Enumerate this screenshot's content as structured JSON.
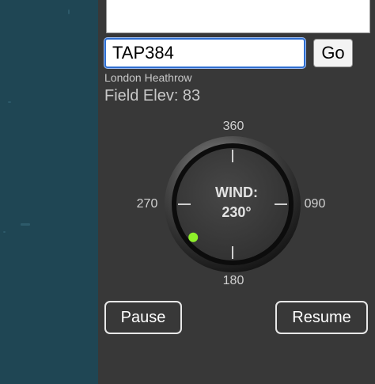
{
  "flight_search": {
    "input_value": "TAP384",
    "go_label": "Go"
  },
  "airport": {
    "name": "London Heathrow",
    "field_elev": "Field Elev: 83"
  },
  "wind_gauge": {
    "label": "WIND:",
    "value": "230°",
    "direction_deg": 230,
    "marks": {
      "north": "360",
      "east": "090",
      "south": "180",
      "west": "270"
    },
    "indicator_color": "#8ef02a"
  },
  "controls": {
    "pause_label": "Pause",
    "resume_label": "Resume"
  }
}
